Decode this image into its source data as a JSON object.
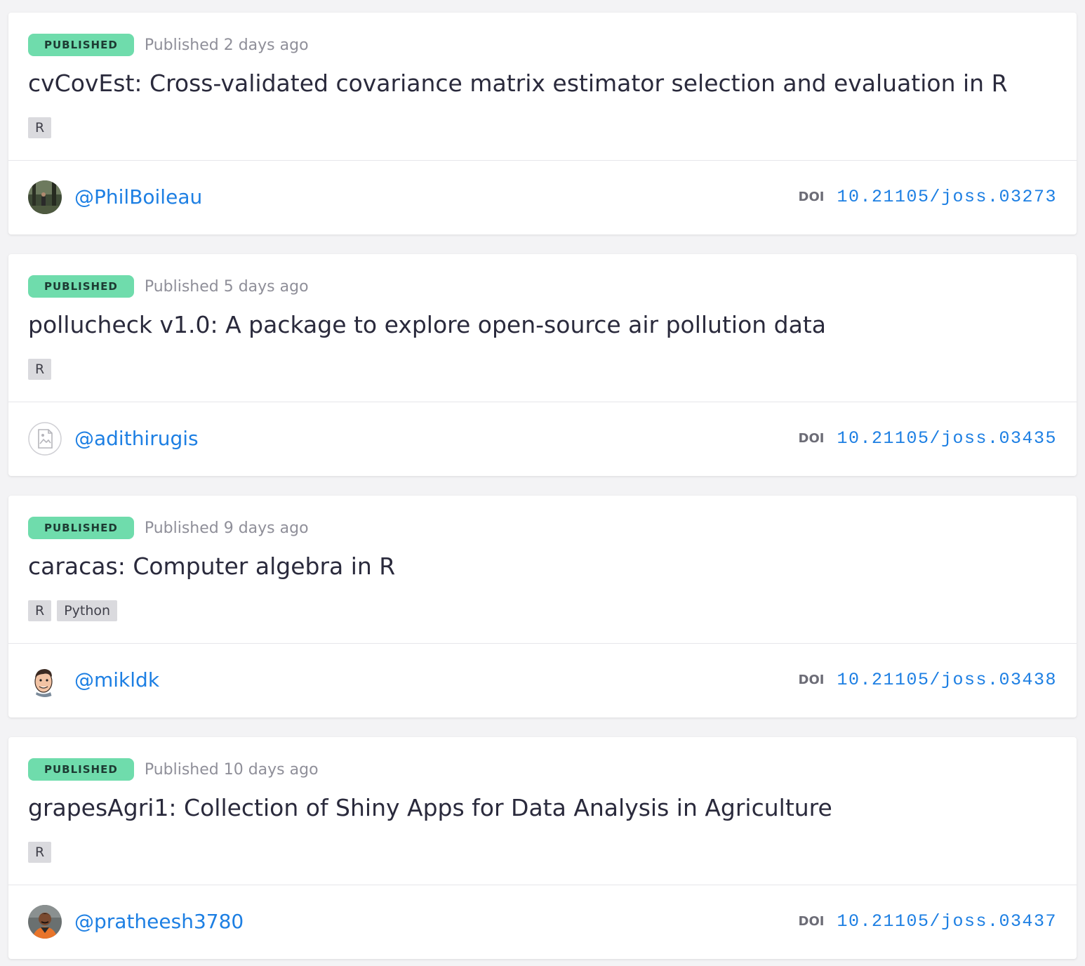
{
  "papers": [
    {
      "status": "PUBLISHED",
      "published": "Published 2 days ago",
      "title": "cvCovEst: Cross-validated covariance matrix estimator selection and evaluation in R",
      "tags": [
        "R"
      ],
      "author": "@PhilBoileau",
      "doi_label": "DOI",
      "doi": "10.21105/joss.03273"
    },
    {
      "status": "PUBLISHED",
      "published": "Published 5 days ago",
      "title": "pollucheck v1.0: A package to explore open-source air pollution data",
      "tags": [
        "R"
      ],
      "author": "@adithirugis",
      "doi_label": "DOI",
      "doi": "10.21105/joss.03435"
    },
    {
      "status": "PUBLISHED",
      "published": "Published 9 days ago",
      "title": "caracas: Computer algebra in R",
      "tags": [
        "R",
        "Python"
      ],
      "author": "@mikldk",
      "doi_label": "DOI",
      "doi": "10.21105/joss.03438"
    },
    {
      "status": "PUBLISHED",
      "published": "Published 10 days ago",
      "title": "grapesAgri1: Collection of Shiny Apps for Data Analysis in Agriculture",
      "tags": [
        "R"
      ],
      "author": "@pratheesh3780",
      "doi_label": "DOI",
      "doi": "10.21105/joss.03437"
    }
  ],
  "colors": {
    "badge_bg": "#6fdcac",
    "link": "#1d7fe3",
    "title": "#2a2a3c",
    "tag_bg": "#dadade",
    "page_bg": "#f3f3f5"
  }
}
